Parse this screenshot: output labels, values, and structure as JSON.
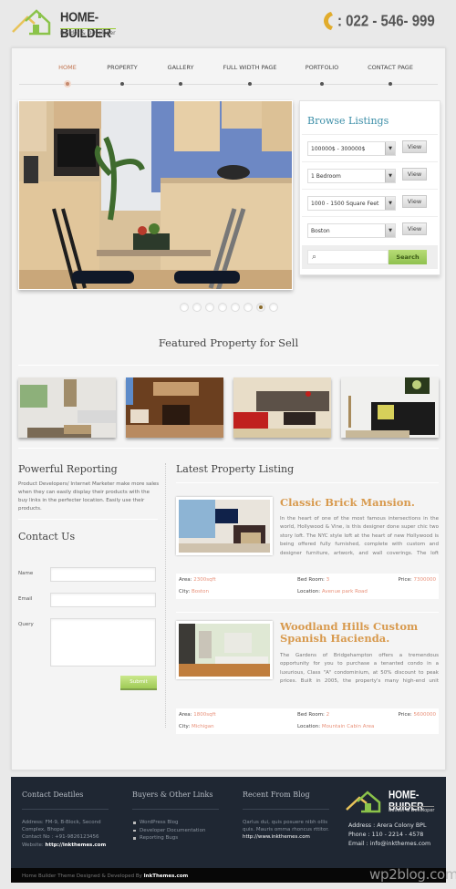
{
  "header": {
    "logo_title": "HOME-BUILDER",
    "logo_subtitle": "Builder & Developer",
    "phone_icon": "phone-icon",
    "phone": ": 022 - 546- 999"
  },
  "nav": {
    "items": [
      {
        "label": "HOME",
        "active": true
      },
      {
        "label": "PROPERTY",
        "active": false
      },
      {
        "label": "GALLERY",
        "active": false
      },
      {
        "label": "FULL WIDTH PAGE",
        "active": false
      },
      {
        "label": "PORTFOLIO",
        "active": false
      },
      {
        "label": "CONTACT PAGE",
        "active": false
      }
    ]
  },
  "slider": {
    "image": "kitchen-dining-photo",
    "slides": 8,
    "active_slide": 7
  },
  "browse": {
    "title": "Browse Listings",
    "filters": [
      {
        "value": "100000$ - 300000$",
        "button": "View"
      },
      {
        "value": "1 Bedroom",
        "button": "View"
      },
      {
        "value": "1000 - 1500 Square Feet",
        "button": "View"
      },
      {
        "value": "Boston",
        "button": "View"
      }
    ],
    "search_placeholder": "",
    "search_button": "Search"
  },
  "featured": {
    "title": "Featured Property for Sell",
    "thumbs": [
      "living-room-white",
      "wooden-chalet",
      "living-room-red-sofa",
      "living-room-black-sofa"
    ]
  },
  "reporting": {
    "title": "Powerful Reporting",
    "text": "Product Developers/ Internet Marketer make more sales when they can easily display their products with the buy links in the perfecter location. Easily use their products."
  },
  "contact": {
    "title": "Contact Us",
    "name_label": "Name",
    "email_label": "Email",
    "query_label": "Query",
    "name_value": "",
    "email_value": "",
    "query_value": "",
    "submit": "Submit"
  },
  "latest": {
    "title": "Latest Property Listing",
    "listings": [
      {
        "title": "Classic Brick Mansion.",
        "desc": "In the heart of one of the most famous intersections in the world, Hollywood & Vine, is this designer done super chic two story loft. The NYC style loft at the heart of new Hollywood is being offered fully furnished, complete with custom and designer furniture, artwork, and wall coverings. The loft features soaring ceilings. [...]",
        "area_label": "Area:",
        "area": "2300sqft",
        "bed_label": "Bed Room:",
        "bed": "3",
        "price_label": "Price:",
        "price": "7300000",
        "city_label": "City:",
        "city": "Boston",
        "loc_label": "Location:",
        "location": "Avenue park Road"
      },
      {
        "title": "Woodland Hills Custom Spanish Hacienda.",
        "desc": "The Gardens of Bridgehampton offers a tremendous opportunity for you to purchase a tenanted condo in a luxurious, Class \"A\" condominium, at 50% discount to peak prices. Built in 2005, the property's many high-end unit features, variety of floor plans and extensive community amenities place it among the most luxurious multi-family communities in the marketplace. [...]",
        "area_label": "Area:",
        "area": "1800sqft",
        "bed_label": "Bed Room:",
        "bed": "2",
        "price_label": "Price:",
        "price": "5600000",
        "city_label": "City:",
        "city": "Michigan",
        "loc_label": "Location:",
        "location": "Mountain Cabin Area"
      }
    ]
  },
  "footer": {
    "contact_title": "Contact Deatiles",
    "contact_address": "Address: FM-9, B-Block, Second Complex, Bhopal",
    "contact_phone": "Contact No : +91-9826123456",
    "contact_website_label": "Website:",
    "contact_website": "http://inkthemes.com",
    "links_title": "Buyers & Other Links",
    "links": [
      "WordPress Blog",
      "Developer Documentation",
      "Reporting Bugs"
    ],
    "blog_title": "Recent From Blog",
    "blog_text": "Qarlus dui, quis posuere nibh ollis quis. Mauris omma rhoncus rttitor.",
    "blog_link": "http://www.inkthemes.com",
    "logo_title": "HOME-BUIDER",
    "logo_subtitle": "Builder & Developer",
    "address": "Address : Arera Colony BPL",
    "phone": "Phone : 110 - 2214 - 4578",
    "email": "Email : info@inkthemes.com",
    "copyright_prefix": "Home Builder Theme Designed & Developed By",
    "copyright_link": "InkThemes.com"
  },
  "watermark": "wp2blog.com"
}
